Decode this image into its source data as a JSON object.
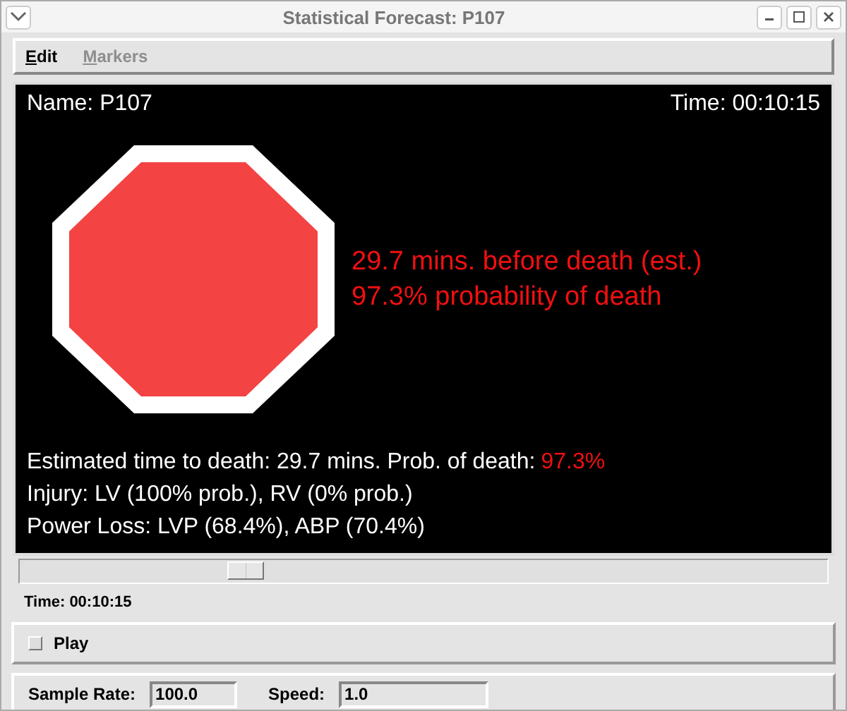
{
  "window": {
    "title": "Statistical Forecast: P107"
  },
  "menu": [
    {
      "label": "Edit",
      "disabled": false
    },
    {
      "label": "Markers",
      "disabled": true
    }
  ],
  "display": {
    "name": "Name: P107",
    "time": "Time: 00:10:15",
    "forecast": [
      "29.7 mins. before death (est.)",
      "97.3% probability of death"
    ],
    "summary": {
      "label": "Estimated time to death: 29.7 mins. Prob. of death:",
      "value": "97.3%"
    },
    "lines": [
      "Injury: LV (100% prob.), RV (0% prob.)",
      "Power Loss: LVP (68.4%), ABP (70.4%)"
    ]
  },
  "slider": {
    "level": 0.28
  },
  "time_label": "Time: 00:10:15",
  "play": {
    "label": "Play",
    "checked": false
  },
  "fields": [
    {
      "label": "Sample Rate:",
      "value": "100.0"
    },
    {
      "label": "Speed:",
      "value": "1.0"
    }
  ]
}
